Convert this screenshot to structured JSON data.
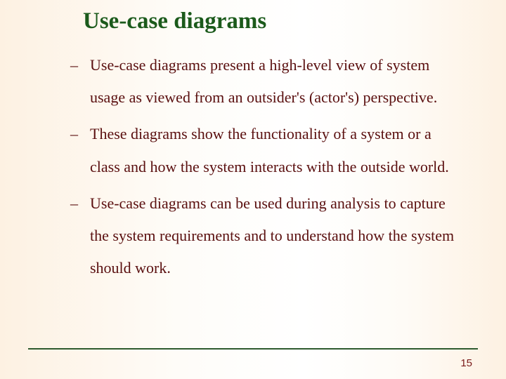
{
  "slide": {
    "title": "Use-case diagrams",
    "bullets": [
      "Use-case diagrams present a high-level view of system usage as viewed from an outsider's (actor's) perspective.",
      "These diagrams show the functionality of a system or a class and how the system interacts with the outside world.",
      "Use-case diagrams can be used during analysis to capture the system requirements and to understand how the system should work."
    ],
    "dash": "–",
    "page_number": "15"
  }
}
